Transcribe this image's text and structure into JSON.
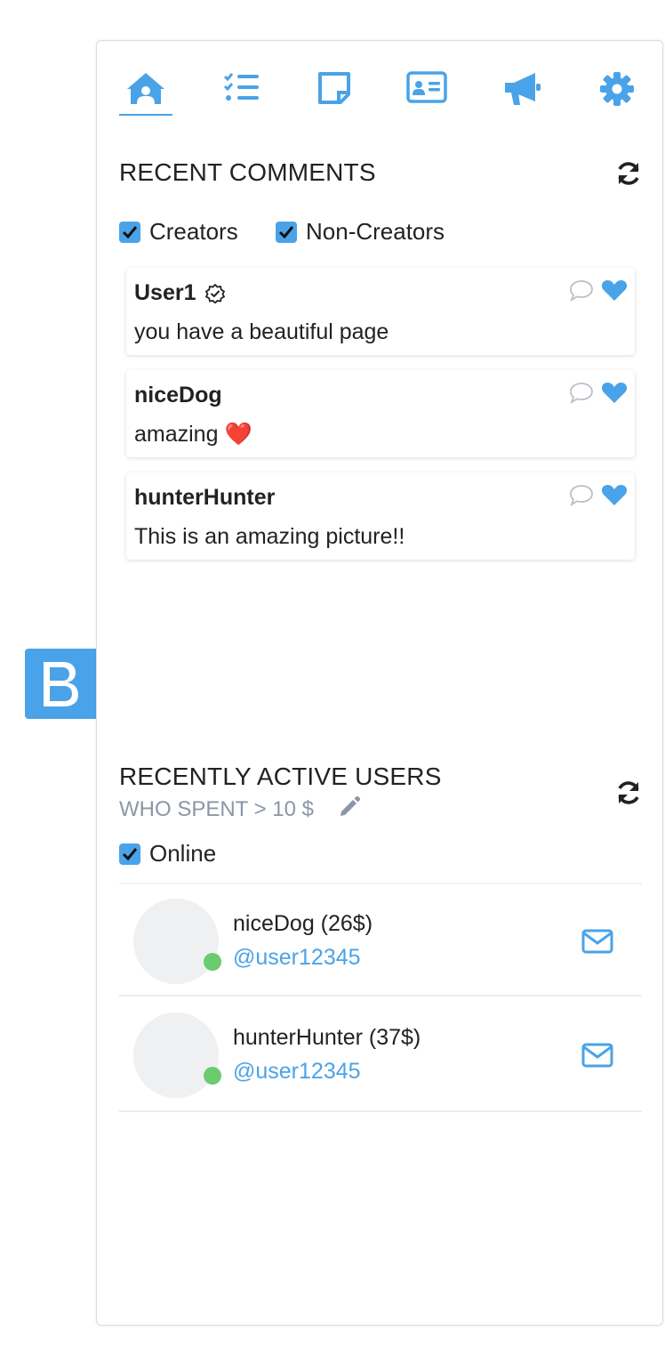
{
  "nav": {
    "tabs": [
      {
        "icon": "home-icon",
        "active": true
      },
      {
        "icon": "checklist-icon",
        "active": false
      },
      {
        "icon": "note-icon",
        "active": false
      },
      {
        "icon": "id-card-icon",
        "active": false
      },
      {
        "icon": "megaphone-icon",
        "active": false
      },
      {
        "icon": "gear-icon",
        "active": false
      }
    ]
  },
  "accent_color": "#4aa3e8",
  "recent_comments": {
    "title": "RECENT COMMENTS",
    "filters": [
      {
        "label": "Creators",
        "checked": true
      },
      {
        "label": "Non-Creators",
        "checked": true
      }
    ],
    "items": [
      {
        "author": "User1",
        "verified": true,
        "text": "you have a beautiful page"
      },
      {
        "author": "niceDog",
        "verified": false,
        "text": "amazing ❤️"
      },
      {
        "author": "hunterHunter",
        "verified": false,
        "text": "This is an amazing picture!!"
      }
    ]
  },
  "side_tab": {
    "letter": "B"
  },
  "recent_users": {
    "title": "RECENTLY ACTIVE USERS",
    "subtitle": "WHO SPENT > 10 $",
    "filter": {
      "label": "Online",
      "checked": true
    },
    "items": [
      {
        "name": "niceDog (26$)",
        "handle": "@user12345",
        "online": true
      },
      {
        "name": "hunterHunter (37$)",
        "handle": "@user12345",
        "online": true
      }
    ]
  }
}
